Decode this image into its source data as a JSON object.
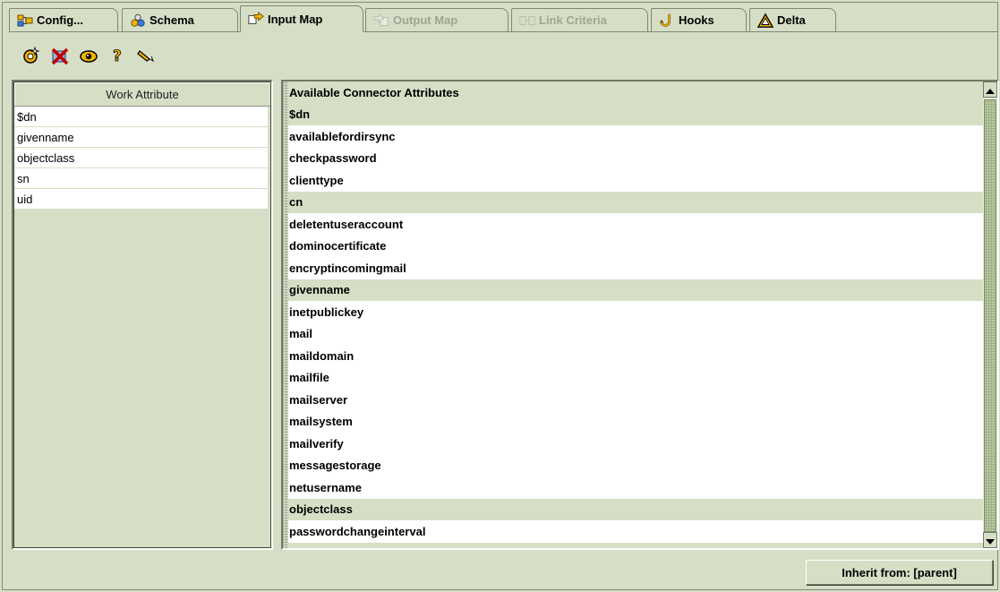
{
  "tabs": [
    {
      "label": "Config...",
      "icon": "config-icon",
      "state": "normal"
    },
    {
      "label": "Schema",
      "icon": "schema-icon",
      "state": "normal"
    },
    {
      "label": "Input Map",
      "icon": "input-map-icon",
      "state": "active"
    },
    {
      "label": "Output Map",
      "icon": "output-map-icon",
      "state": "disabled"
    },
    {
      "label": "Link Criteria",
      "icon": "link-criteria-icon",
      "state": "disabled"
    },
    {
      "label": "Hooks",
      "icon": "hooks-icon",
      "state": "normal"
    },
    {
      "label": "Delta",
      "icon": "delta-icon",
      "state": "normal"
    }
  ],
  "toolbar": [
    {
      "icon": "add-attribute-icon"
    },
    {
      "icon": "delete-attribute-icon"
    },
    {
      "icon": "view-icon"
    },
    {
      "icon": "help-icon"
    },
    {
      "icon": "edit-icon"
    }
  ],
  "work_attributes": {
    "header": "Work Attribute",
    "items": [
      "$dn",
      "givenname",
      "objectclass",
      "sn",
      "uid"
    ]
  },
  "connector_attributes": {
    "header": "Available Connector Attributes",
    "items": [
      {
        "name": "$dn",
        "mapped": true
      },
      {
        "name": "availablefordirsync",
        "mapped": false
      },
      {
        "name": "checkpassword",
        "mapped": false
      },
      {
        "name": "clienttype",
        "mapped": false
      },
      {
        "name": "cn",
        "mapped": true
      },
      {
        "name": "deletentuseraccount",
        "mapped": false
      },
      {
        "name": "dominocertificate",
        "mapped": false
      },
      {
        "name": "encryptincomingmail",
        "mapped": false
      },
      {
        "name": "givenname",
        "mapped": true
      },
      {
        "name": "inetpublickey",
        "mapped": false
      },
      {
        "name": "mail",
        "mapped": false
      },
      {
        "name": "maildomain",
        "mapped": false
      },
      {
        "name": "mailfile",
        "mapped": false
      },
      {
        "name": "mailserver",
        "mapped": false
      },
      {
        "name": "mailsystem",
        "mapped": false
      },
      {
        "name": "mailverify",
        "mapped": false
      },
      {
        "name": "messagestorage",
        "mapped": false
      },
      {
        "name": "netusername",
        "mapped": false
      },
      {
        "name": "objectclass",
        "mapped": true
      },
      {
        "name": "passwordchangeinterval",
        "mapped": false
      }
    ]
  },
  "inherit_button": {
    "label": "Inherit from: [parent]"
  },
  "colors": {
    "background": "#d6dfc6",
    "highlight_row": "#d6dfc6",
    "scroll_thumb": "#b8c9a0"
  }
}
